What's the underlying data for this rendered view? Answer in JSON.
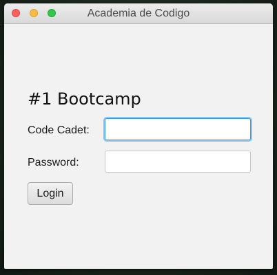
{
  "window": {
    "title": "Academia de Codigo"
  },
  "form": {
    "heading": "#1 Bootcamp",
    "code_cadet_label": "Code Cadet:",
    "code_cadet_value": "",
    "password_label": "Password:",
    "password_value": "",
    "login_label": "Login"
  },
  "colors": {
    "focus_ring": "#3b99d8",
    "close": "#fc605c",
    "minimize": "#fdbc40",
    "maximize": "#34c84a"
  }
}
